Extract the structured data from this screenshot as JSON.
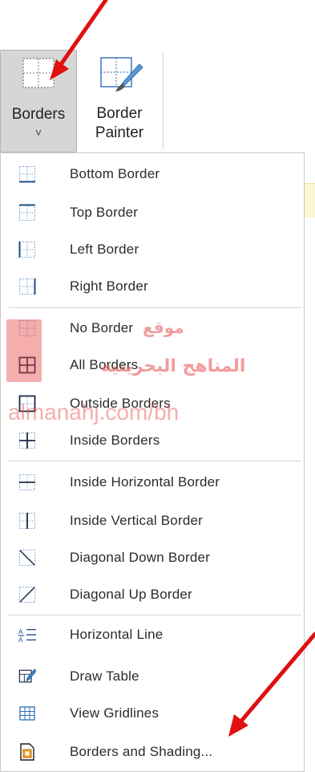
{
  "ribbon": {
    "borders_label": "Borders",
    "border_painter_line1": "Border",
    "border_painter_line2": "Painter",
    "chevron": "˅"
  },
  "menu": {
    "items": [
      {
        "label": "Bottom Border",
        "icon": "bottom-border-icon"
      },
      {
        "label": "Top Border",
        "icon": "top-border-icon"
      },
      {
        "label": "Left Border",
        "icon": "left-border-icon"
      },
      {
        "label": "Right Border",
        "icon": "right-border-icon"
      },
      {
        "label": "No Border",
        "icon": "no-border-icon"
      },
      {
        "label": "All Borders",
        "icon": "all-borders-icon"
      },
      {
        "label": "Outside Borders",
        "icon": "outside-borders-icon"
      },
      {
        "label": "Inside Borders",
        "icon": "inside-borders-icon"
      },
      {
        "label": "Inside Horizontal Border",
        "icon": "inside-horizontal-border-icon"
      },
      {
        "label": "Inside Vertical Border",
        "icon": "inside-vertical-border-icon"
      },
      {
        "label": "Diagonal Down Border",
        "icon": "diagonal-down-border-icon"
      },
      {
        "label": "Diagonal Up Border",
        "icon": "diagonal-up-border-icon"
      },
      {
        "label": "Horizontal Line",
        "icon": "horizontal-line-icon"
      },
      {
        "label": "Draw Table",
        "icon": "draw-table-icon"
      },
      {
        "label": "View Gridlines",
        "icon": "view-gridlines-icon"
      },
      {
        "label": "Borders and Shading...",
        "icon": "borders-and-shading-icon"
      }
    ]
  },
  "watermark": {
    "line1": "موقع",
    "line2": "المناهج البحرينية",
    "line3": "almanahj.com/bh"
  },
  "colors": {
    "annotation_arrow": "#e01010",
    "watermark": "#e84a4a",
    "pressed_button": "#d6d6d6",
    "icon_blue": "#2e6fb6"
  }
}
